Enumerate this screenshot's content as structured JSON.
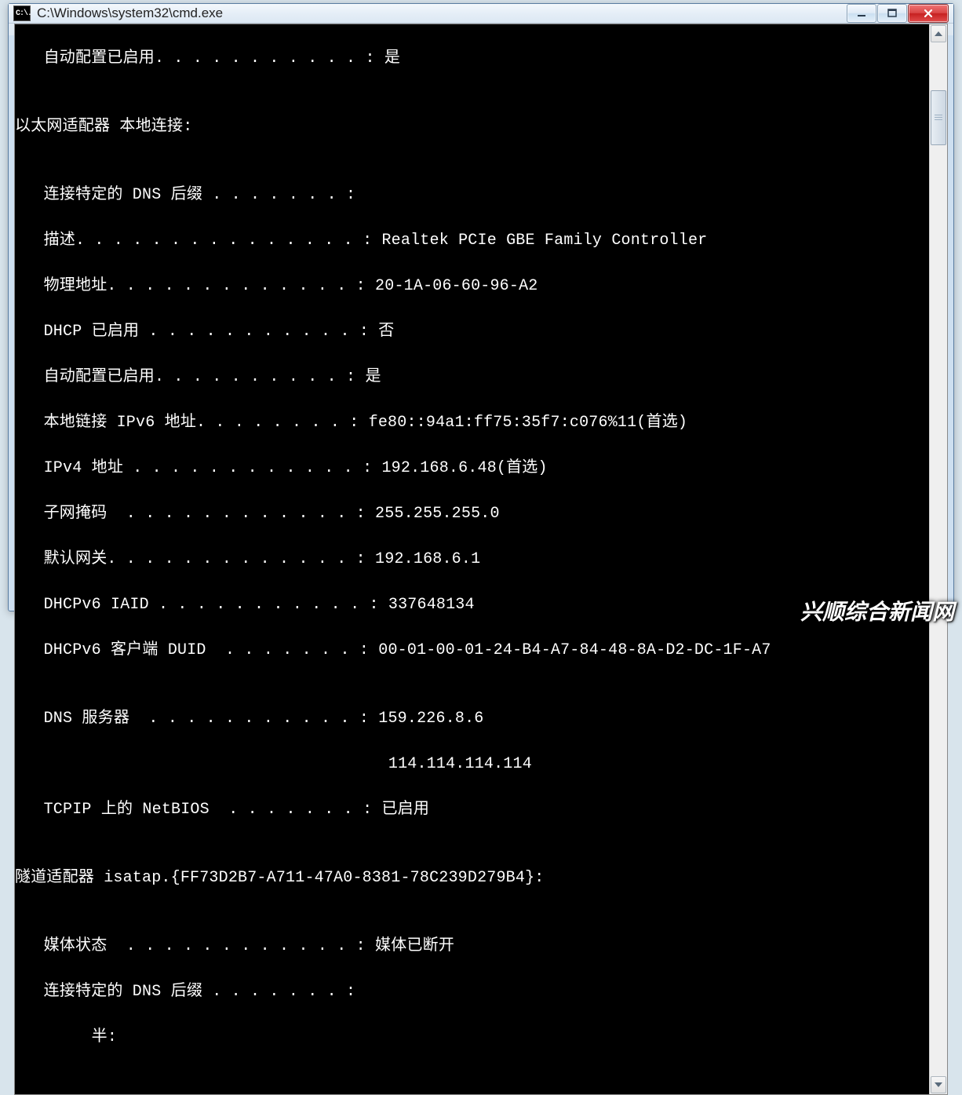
{
  "window": {
    "title": "C:\\Windows\\system32\\cmd.exe",
    "app_icon_text": "C:\\."
  },
  "term": {
    "top_line": {
      "label": "   自动配置已启用. . . . . . . . . . . :",
      "value": " 是"
    },
    "section1_header": "以太网适配器 本地连接:",
    "section1_lines": [
      {
        "label": "   连接特定的 DNS 后缀 . . . . . . . :",
        "value": ""
      },
      {
        "label": "   描述. . . . . . . . . . . . . . . :",
        "value": " Realtek PCIe GBE Family Controller"
      },
      {
        "label": "   物理地址. . . . . . . . . . . . . :",
        "value": " 20-1A-06-60-96-A2"
      },
      {
        "label": "   DHCP 已启用 . . . . . . . . . . . :",
        "value": " 否"
      },
      {
        "label": "   自动配置已启用. . . . . . . . . . :",
        "value": " 是"
      },
      {
        "label": "   本地链接 IPv6 地址. . . . . . . . :",
        "value": " fe80::94a1:ff75:35f7:c076%11(首选)"
      },
      {
        "label": "   IPv4 地址 . . . . . . . . . . . . :",
        "value": " 192.168.6.48(首选)"
      },
      {
        "label": "   子网掩码  . . . . . . . . . . . . :",
        "value": " 255.255.255.0"
      },
      {
        "label": "   默认网关. . . . . . . . . . . . . :",
        "value": " 192.168.6.1"
      },
      {
        "label": "   DHCPv6 IAID . . . . . . . . . . . :",
        "value": " 337648134"
      },
      {
        "label": "   DHCPv6 客户端 DUID  . . . . . . . :",
        "value": " 00-01-00-01-24-B4-A7-84-48-8A-D2-DC-1F-A7"
      }
    ],
    "dns_line": {
      "label": "   DNS 服务器  . . . . . . . . . . . :",
      "value": " 159.226.8.6"
    },
    "dns_extra": "                                       114.114.114.114",
    "netbios_line": {
      "label": "   TCPIP 上的 NetBIOS  . . . . . . . :",
      "value": " 已启用"
    },
    "section2_header": "隧道适配器 isatap.{FF73D2B7-A711-47A0-8381-78C239D279B4}:",
    "section2_lines": [
      {
        "label": "   媒体状态  . . . . . . . . . . . . :",
        "value": " 媒体已断开"
      },
      {
        "label": "   连接特定的 DNS 后缀 . . . . . . . :",
        "value": ""
      }
    ],
    "partial_line": "        半:"
  },
  "watermark": "兴顺综合新闻网"
}
